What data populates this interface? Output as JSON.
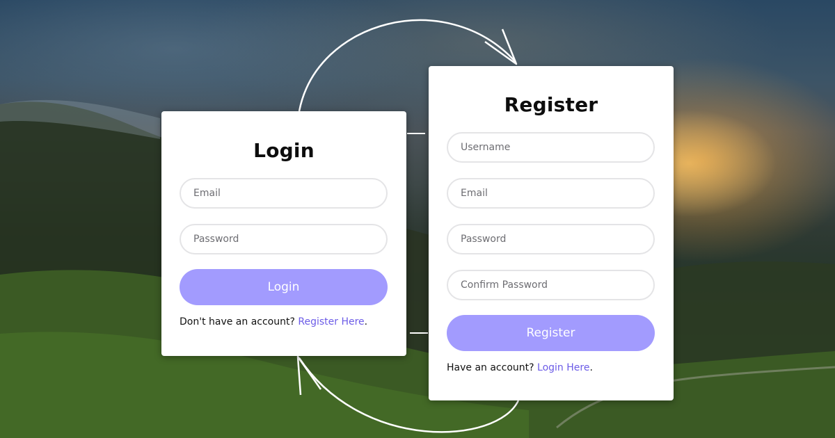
{
  "login": {
    "title": "Login",
    "email_placeholder": "Email",
    "password_placeholder": "Password",
    "button_label": "Login",
    "switch_prompt": "Don't have an account?",
    "switch_link": "Register Here",
    "switch_suffix": "."
  },
  "register": {
    "title": "Register",
    "username_placeholder": "Username",
    "email_placeholder": "Email",
    "password_placeholder": "Password",
    "confirm_password_placeholder": "Confirm Password",
    "button_label": "Register",
    "switch_prompt": "Have an account?",
    "switch_link": "Login Here",
    "switch_suffix": "."
  },
  "colors": {
    "accent_button": "#a29bfe",
    "link": "#6c5ce7",
    "card_background": "#ffffff",
    "input_border": "#e4e4e6"
  },
  "icons": {
    "cycle": "circular-arrows-icon"
  }
}
